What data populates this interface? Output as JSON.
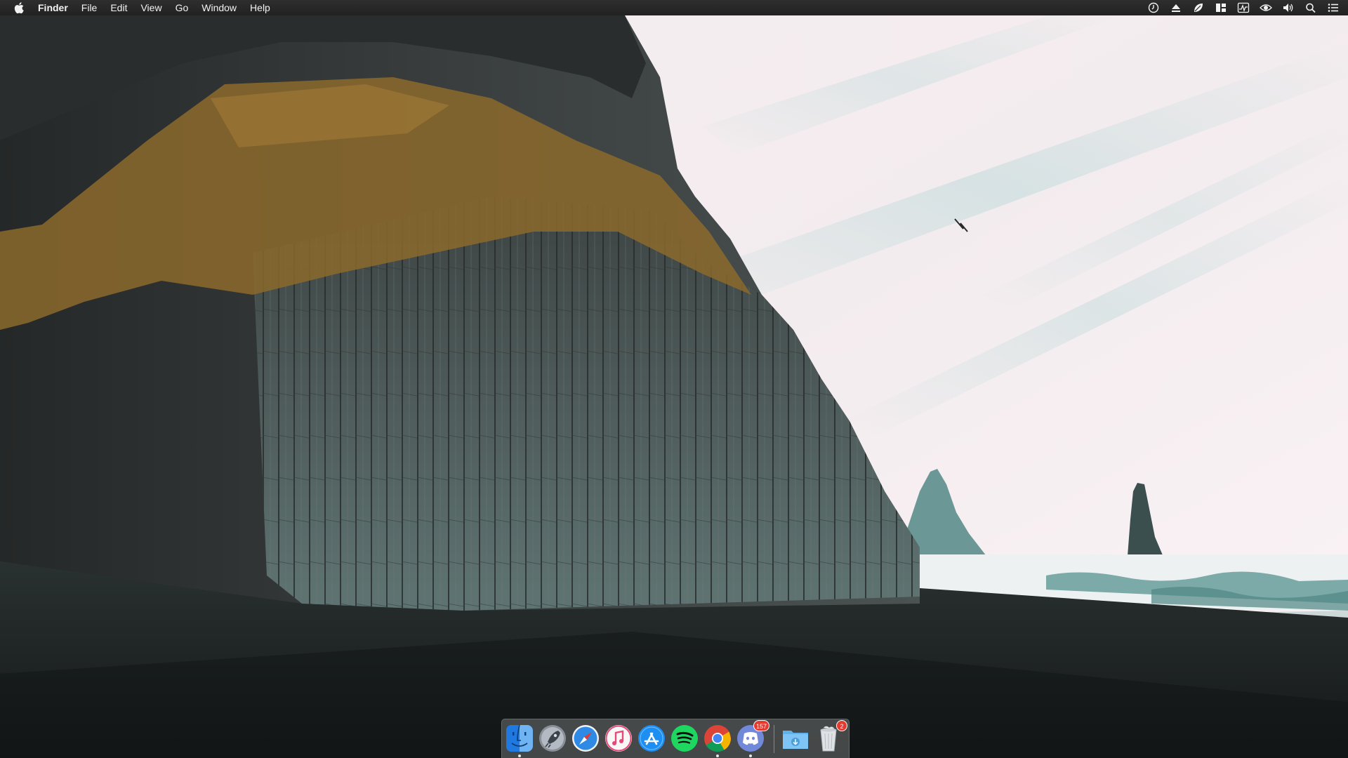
{
  "menubar": {
    "apple_icon": "apple-logo-icon",
    "items": [
      {
        "label": "Finder",
        "bold": true
      },
      {
        "label": "File"
      },
      {
        "label": "Edit"
      },
      {
        "label": "View"
      },
      {
        "label": "Go"
      },
      {
        "label": "Window"
      },
      {
        "label": "Help"
      }
    ],
    "status_icons": [
      "timer-icon",
      "eject-icon",
      "leaf-icon",
      "layout-icon",
      "activity-monitor-icon",
      "eye-icon",
      "volume-icon",
      "spotlight-search-icon",
      "notification-center-icon"
    ]
  },
  "dock": {
    "apps": [
      {
        "name": "finder-app",
        "running": true
      },
      {
        "name": "launchpad-app",
        "running": false
      },
      {
        "name": "safari-app",
        "running": false
      },
      {
        "name": "itunes-app",
        "running": false
      },
      {
        "name": "app-store-app",
        "running": false
      },
      {
        "name": "spotify-app",
        "running": false
      },
      {
        "name": "chrome-app",
        "running": true
      },
      {
        "name": "discord-app",
        "running": true,
        "badge": "157"
      },
      {
        "name": "downloads-folder",
        "running": false
      },
      {
        "name": "trash",
        "running": false,
        "badge": "2"
      }
    ]
  },
  "colors": {
    "menubar_bg": "#222222",
    "sky_top": "#eef2f2",
    "sky_teal": "#bcd9d8",
    "rock_dark": "#2b2f30",
    "moss": "#8a6a2a",
    "sand": "#1f2424",
    "badge_red": "#e43a30"
  }
}
